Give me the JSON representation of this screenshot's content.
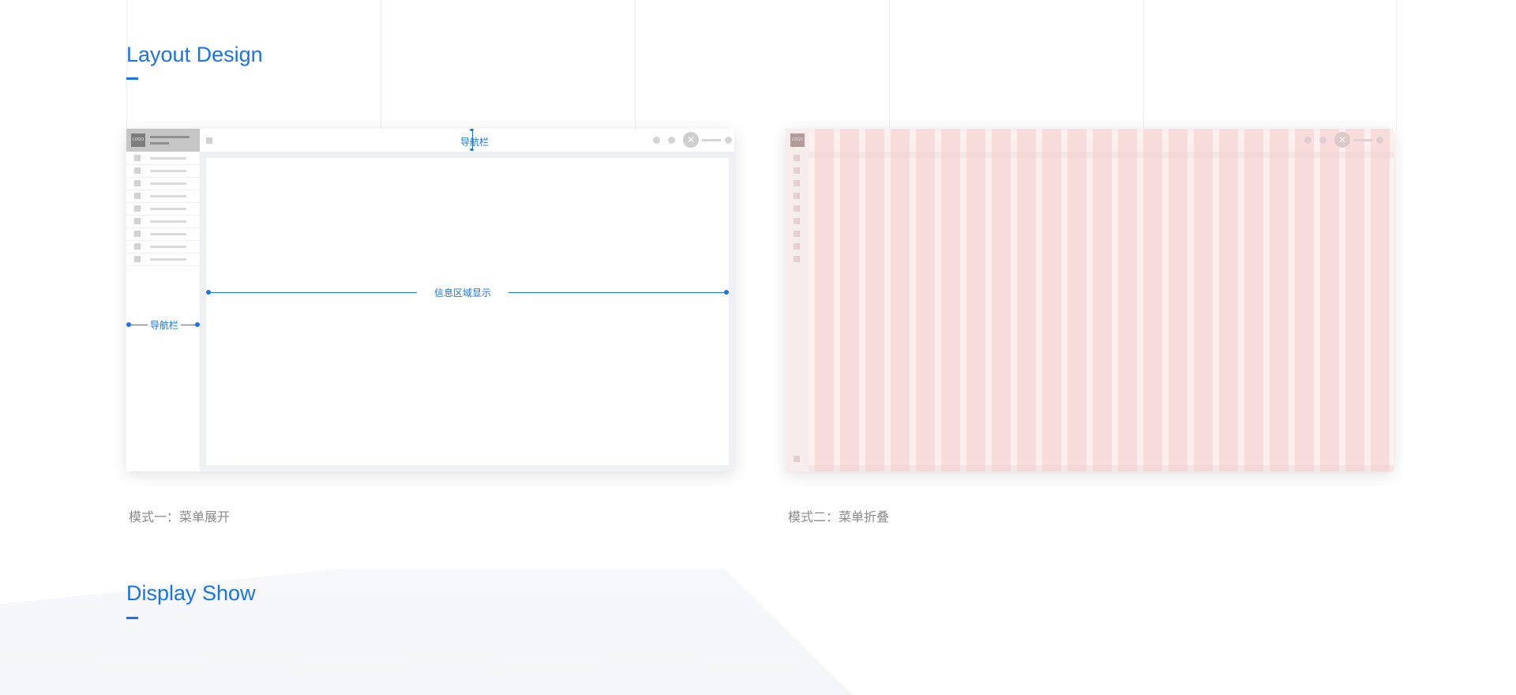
{
  "sections": {
    "layout_title": "Layout Design",
    "display_title": "Display Show"
  },
  "mode1": {
    "caption": "模式一：菜单展开",
    "logo_text": "LOGO",
    "top_nav_label": "导航栏",
    "side_nav_label": "导航栏",
    "content_label": "信息区域显示",
    "avatar_glyph": "✕"
  },
  "mode2": {
    "caption": "模式二：菜单折叠",
    "logo_text": "LOGO",
    "avatar_glyph": "✕"
  },
  "colors": {
    "accent": "#1a73e8",
    "grid_column": "#f5b0b0"
  }
}
